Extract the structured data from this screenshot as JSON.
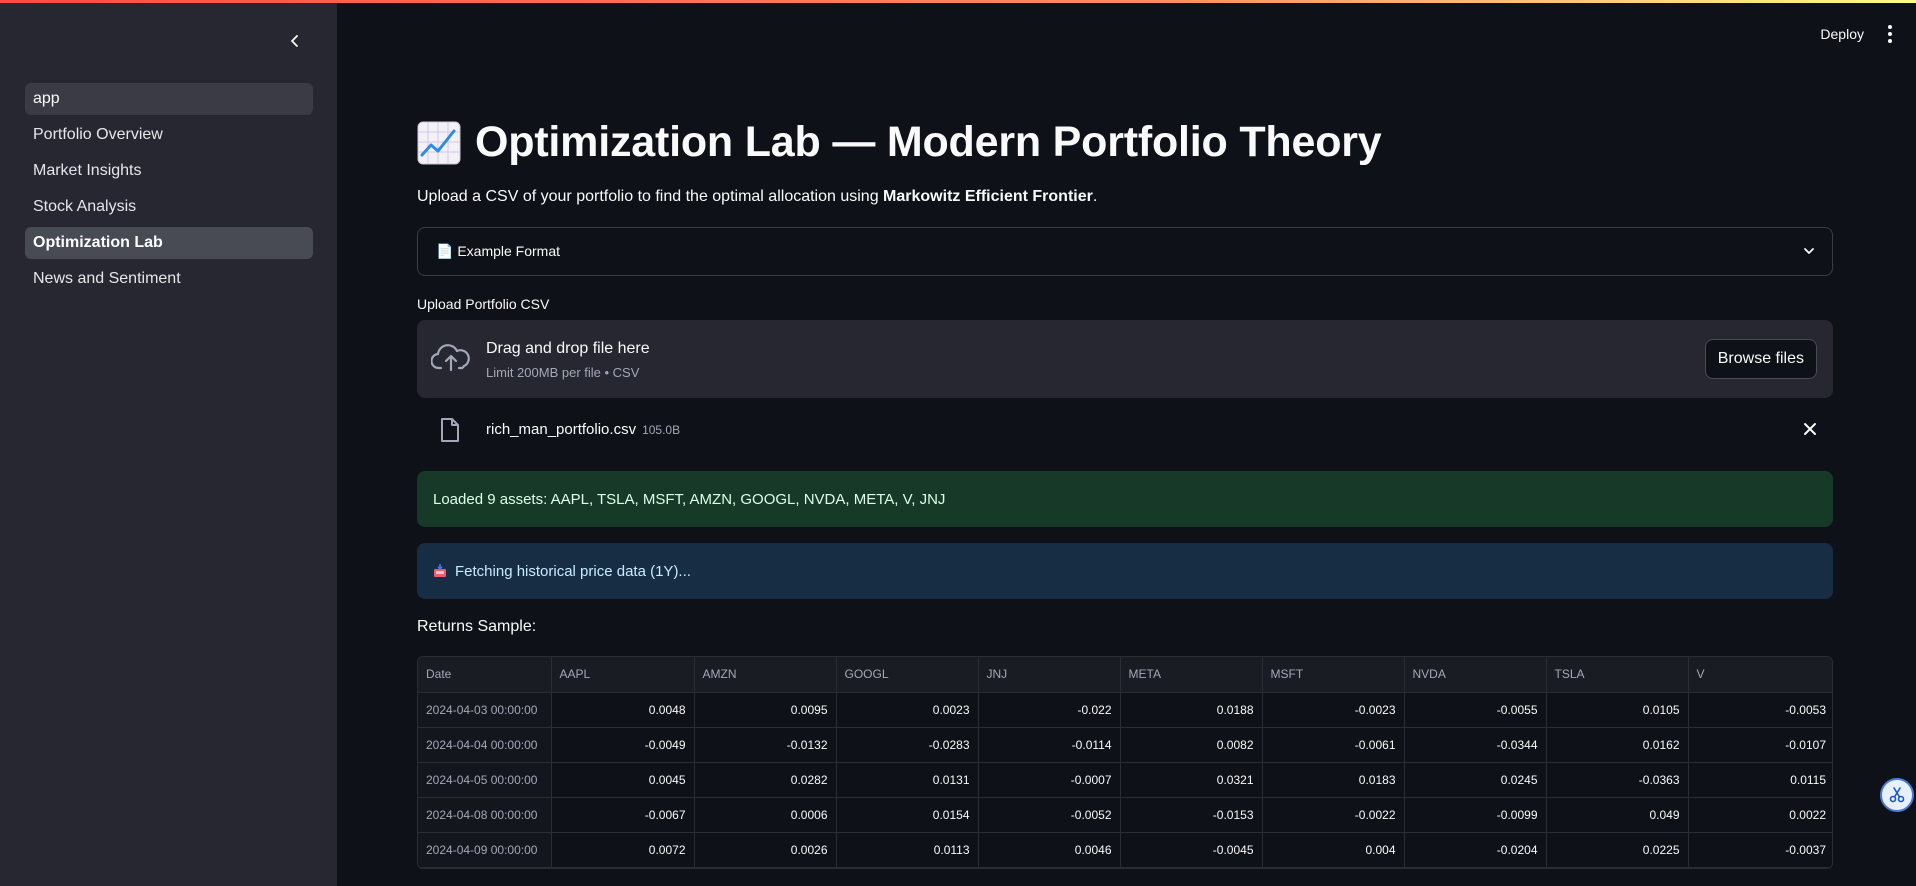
{
  "sidebar": {
    "items": [
      {
        "label": "app"
      },
      {
        "label": "Portfolio Overview"
      },
      {
        "label": "Market Insights"
      },
      {
        "label": "Stock Analysis"
      },
      {
        "label": "Optimization Lab"
      },
      {
        "label": "News and Sentiment"
      }
    ],
    "active_item": "Optimization Lab"
  },
  "header": {
    "deploy_label": "Deploy"
  },
  "page": {
    "title": "Optimization Lab — Modern Portfolio Theory",
    "subtitle_prefix": "Upload a CSV of your portfolio to find the optimal allocation using ",
    "subtitle_bold": "Markowitz Efficient Frontier",
    "subtitle_suffix": "."
  },
  "expander": {
    "icon": "page-icon",
    "label": "📄 Example Format"
  },
  "uploader": {
    "label": "Upload Portfolio CSV",
    "drop_title": "Drag and drop file here",
    "drop_sub": "Limit 200MB per file • CSV",
    "browse_label": "Browse files",
    "file_name": "rich_man_portfolio.csv",
    "file_size": "105.0B"
  },
  "alerts": {
    "success": "Loaded 9 assets: AAPL, TSLA, MSFT, AMZN, GOOGL, NVDA, META, V, JNJ",
    "info": "Fetching historical price data (1Y)..."
  },
  "returns": {
    "label": "Returns Sample:",
    "columns": [
      "Date",
      "AAPL",
      "AMZN",
      "GOOGL",
      "JNJ",
      "META",
      "MSFT",
      "NVDA",
      "TSLA",
      "V"
    ],
    "rows": [
      [
        "2024-04-03 00:00:00",
        "0.0048",
        "0.0095",
        "0.0023",
        "-0.022",
        "0.0188",
        "-0.0023",
        "-0.0055",
        "0.0105",
        "-0.0053"
      ],
      [
        "2024-04-04 00:00:00",
        "-0.0049",
        "-0.0132",
        "-0.0283",
        "-0.0114",
        "0.0082",
        "-0.0061",
        "-0.0344",
        "0.0162",
        "-0.0107"
      ],
      [
        "2024-04-05 00:00:00",
        "0.0045",
        "0.0282",
        "0.0131",
        "-0.0007",
        "0.0321",
        "0.0183",
        "0.0245",
        "-0.0363",
        "0.0115"
      ],
      [
        "2024-04-08 00:00:00",
        "-0.0067",
        "0.0006",
        "0.0154",
        "-0.0052",
        "-0.0153",
        "-0.0022",
        "-0.0099",
        "0.049",
        "0.0022"
      ],
      [
        "2024-04-09 00:00:00",
        "0.0072",
        "0.0026",
        "0.0113",
        "0.0046",
        "-0.0045",
        "0.004",
        "-0.0204",
        "0.0225",
        "-0.0037"
      ]
    ]
  },
  "colors": {
    "background": "#0e1117",
    "sidebar": "#262730",
    "success_bg": "#173928",
    "info_bg": "#172d43",
    "accent": "#ff4b4b"
  }
}
